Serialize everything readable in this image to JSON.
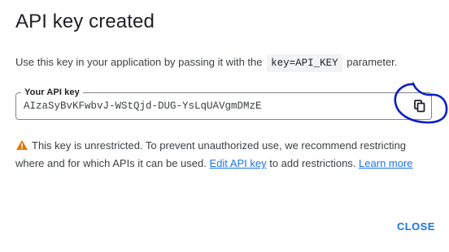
{
  "dialog": {
    "title": "API key created",
    "description": {
      "prefix": "Use this key in your application by passing it with the",
      "code": "key=API_KEY",
      "suffix": "parameter."
    },
    "api_key_field": {
      "label": "Your API key",
      "value": "AIzaSyBvKFwbvJ-WStQjd-DUG-YsLqUAVgmDMzE",
      "copy_icon": "copy-icon"
    },
    "warning": {
      "icon": "warning-icon",
      "text_1": "This key is unrestricted. To prevent unauthorized use, we recommend restricting where and for which APIs it can be used.",
      "link_edit": "Edit API key",
      "text_2": "to add restrictions.",
      "link_learn": "Learn more"
    },
    "close_label": "CLOSE"
  },
  "colors": {
    "link": "#1a73e8",
    "warning": "#e37400",
    "annotation": "#0b1fc4"
  }
}
